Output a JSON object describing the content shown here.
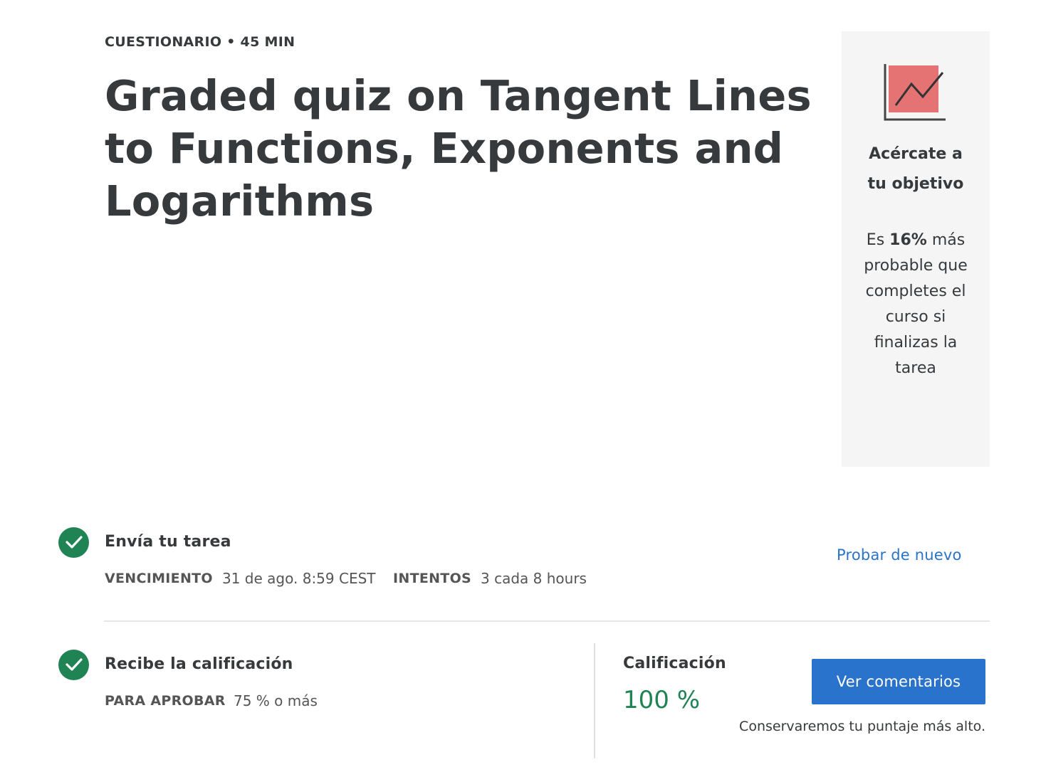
{
  "header": {
    "eyebrow": "CUESTIONARIO • 45 MIN",
    "title": "Graded quiz on Tangent Lines to Functions, Exponents and Logarithms"
  },
  "goal_card": {
    "icon": "trending-chart-icon",
    "heading": "Acércate a tu objetivo",
    "text_prefix": "Es ",
    "text_bold": "16%",
    "text_suffix": " más probable que completes el curso si finalizas la tarea"
  },
  "submit_section": {
    "title": "Envía tu tarea",
    "due_label": "VENCIMIENTO",
    "due_value": "31 de ago. 8:59 CEST",
    "attempts_label": "INTENTOS",
    "attempts_value": "3 cada 8 hours",
    "retry_link": "Probar de nuevo"
  },
  "grade_section": {
    "title": "Recibe la calificación",
    "pass_label": "PARA APROBAR",
    "pass_value": "75 % o más",
    "grade_label": "Calificación",
    "grade_value": "100 %",
    "feedback_button": "Ver comentarios",
    "keep_note": "Conservaremos tu puntaje más alto."
  },
  "colors": {
    "accent_blue": "#2a73cc",
    "success_green": "#1f8354",
    "card_bg": "#f5f5f5",
    "icon_red": "#e57373"
  }
}
